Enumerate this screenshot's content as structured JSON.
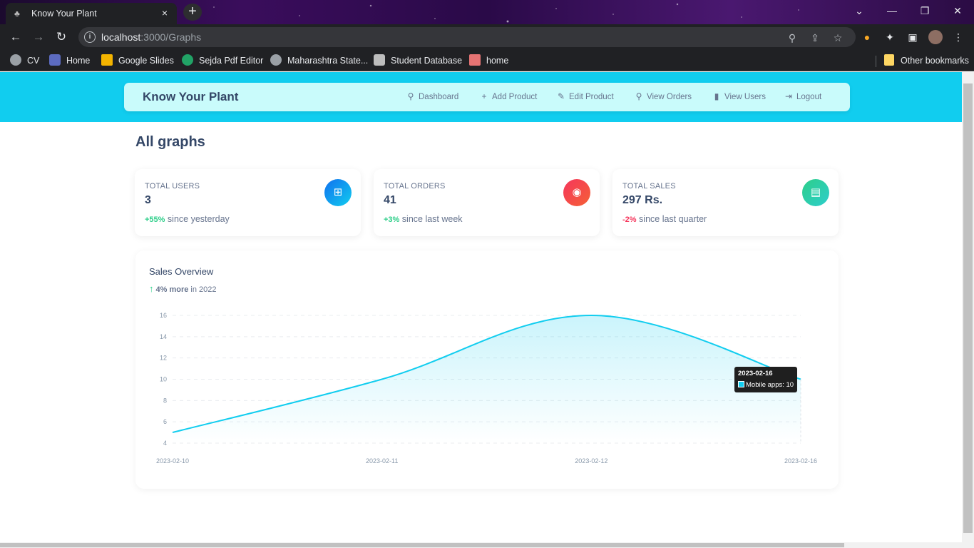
{
  "browser": {
    "tab_title": "Know Your Plant",
    "tab_close": "×",
    "new_tab": "+",
    "url_host": "localhost",
    "url_path": ":3000/Graphs",
    "bookmarks": [
      "CV",
      "Home",
      "Google Slides",
      "Sejda Pdf Editor",
      "Maharashtra State...",
      "Student Database",
      "home"
    ],
    "other_bookmarks": "Other bookmarks"
  },
  "nav": {
    "brand": "Know Your Plant",
    "links": [
      "Dashboard",
      "Add Product",
      "Edit Product",
      "View Orders",
      "View Users",
      "Logout"
    ]
  },
  "page": {
    "title": "All graphs"
  },
  "cards": [
    {
      "label": "Total Users",
      "value": "3",
      "change": "+55%",
      "change_text": " since yesterday",
      "color": "#1a9de6"
    },
    {
      "label": "Total Orders",
      "value": "41",
      "change": "+3%",
      "change_text": " since last week",
      "color": "#f5365c"
    },
    {
      "label": "Total Sales",
      "value": "297 Rs.",
      "change": "-2%",
      "change_text": " since last quarter",
      "color": "#2dce89"
    }
  ],
  "chart_card": {
    "title": "Sales Overview",
    "sub_more": "4% more",
    "sub_rest": " in 2022"
  },
  "chart_data": {
    "type": "area",
    "x": [
      "2023-02-10",
      "2023-02-11",
      "2023-02-12",
      "2023-02-16"
    ],
    "series": [
      {
        "name": "Mobile apps",
        "values": [
          5,
          10,
          16,
          10
        ],
        "color": "#11cdef"
      }
    ],
    "yticks": [
      16,
      14,
      12,
      10,
      8,
      6,
      4
    ],
    "ylim": [
      4,
      16
    ],
    "grid": true,
    "tooltip": {
      "date": "2023-02-16",
      "label": "Mobile apps: 10"
    }
  }
}
